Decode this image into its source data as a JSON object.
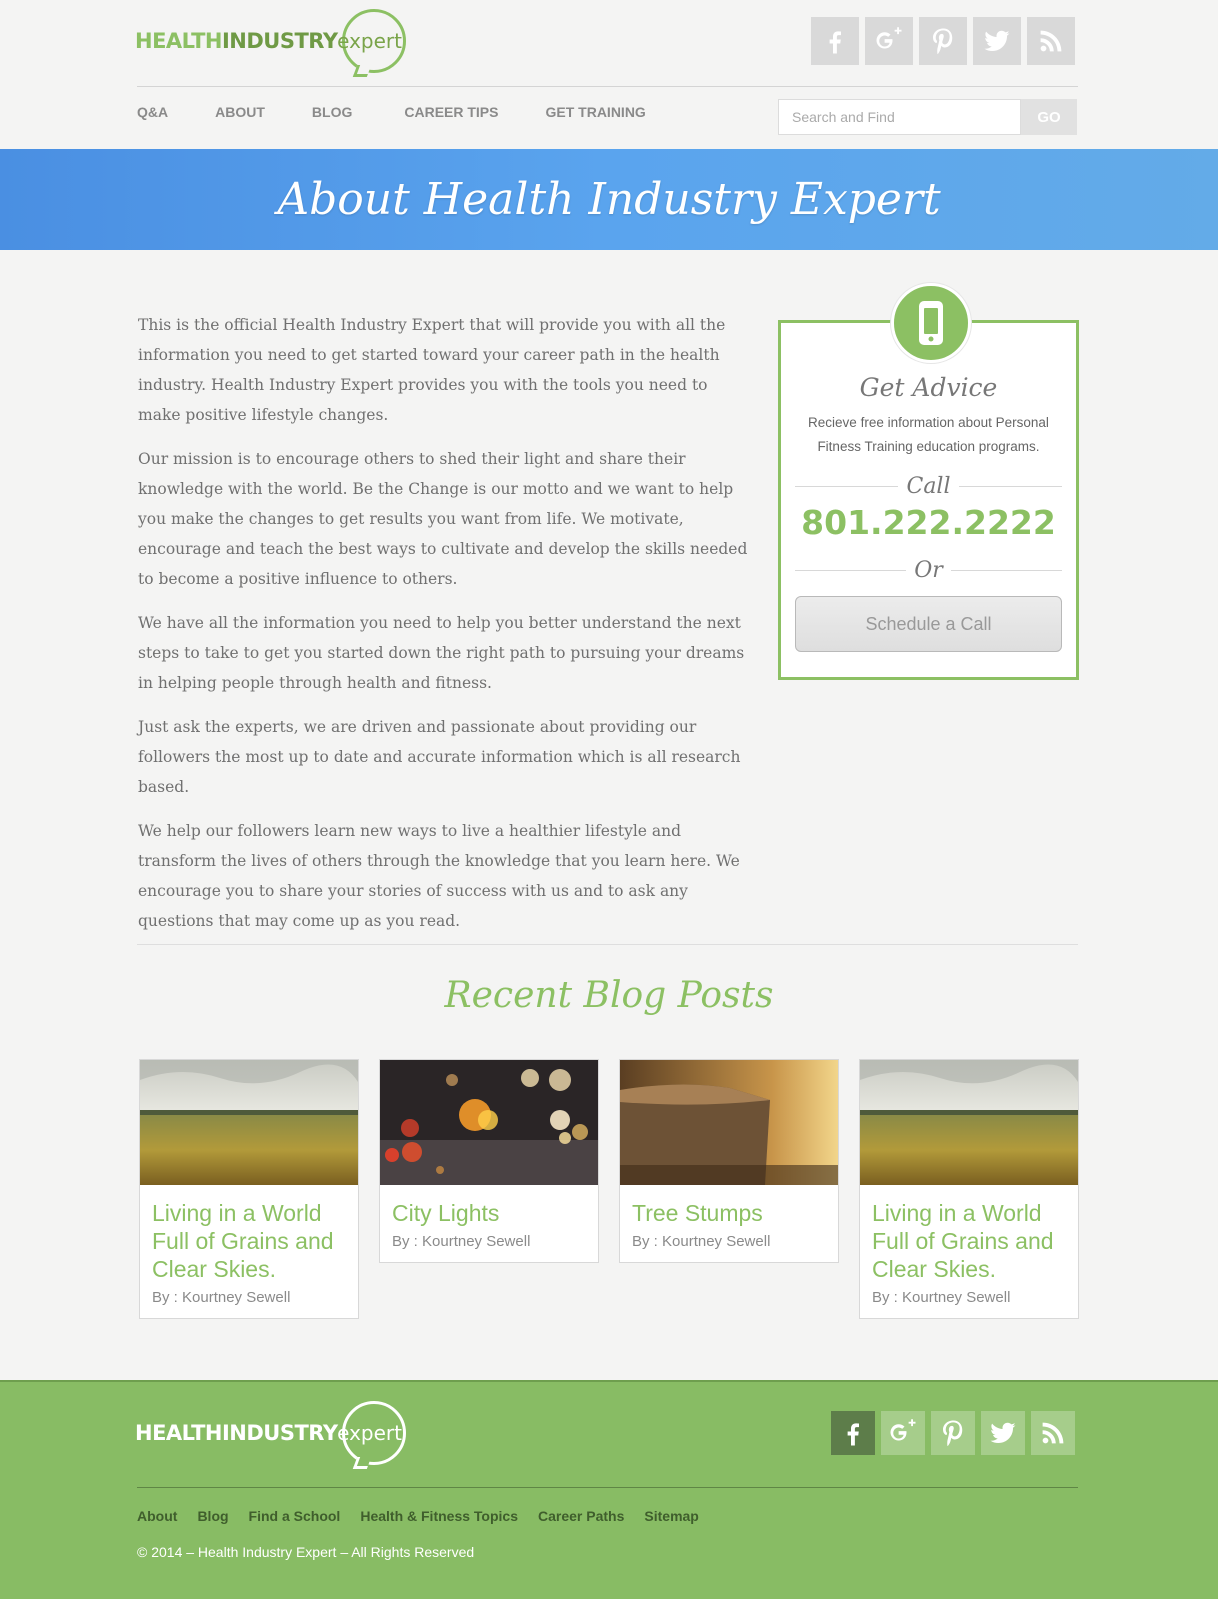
{
  "header": {
    "logo_health": "HEALTH",
    "logo_industry": "INDUSTRY",
    "logo_expert": "expert",
    "social": [
      "facebook-icon",
      "google-plus-icon",
      "pinterest-icon",
      "twitter-icon",
      "rss-icon"
    ]
  },
  "nav": {
    "items": [
      "Q&A",
      "ABOUT",
      "BLOG",
      "CAREER TIPS",
      "GET TRAINING"
    ]
  },
  "search": {
    "placeholder": "Search and Find",
    "button": "GO"
  },
  "banner": {
    "title": "About Health Industry Expert"
  },
  "content": {
    "paragraphs": [
      "This is the official Health Industry Expert that will provide you with all the information you need to get started toward your career path in the health industry. Health Industry Expert provides you with the tools you need to make positive lifestyle changes.",
      "Our mission is to encourage others to shed their light and share their knowledge with the world. Be the Change is our motto and we want to help you make the changes to get results you want from life. We motivate, encourage and teach the best ways to cultivate and develop the skills needed to become a positive influence to others.",
      "We have all the information you need to help you better understand the next steps to take to get you started down the right path to pursuing your dreams in helping people through health and fitness.",
      "Just ask the experts, we are driven and passionate about providing our followers the most up to date and accurate information which is all research based.",
      "We help our followers learn new ways to live a healthier lifestyle and transform the lives of others through the knowledge that you learn here. We encourage you to share your stories of success with us and to ask any questions that may come up as you read."
    ]
  },
  "advice": {
    "icon": "phone-icon",
    "title": "Get Advice",
    "description": "Recieve free information about Personal Fitness Training education programs.",
    "call_label": "Call",
    "phone": "801.222.2222",
    "or_label": "Or",
    "button": "Schedule a Call"
  },
  "recent": {
    "title": "Recent Blog Posts",
    "posts": [
      {
        "title": "Living in a World Full of Grains and Clear Skies.",
        "author": "By : Kourtney Sewell",
        "image": "wheat-field"
      },
      {
        "title": "City Lights",
        "author": "By : Kourtney Sewell",
        "image": "bokeh-lights"
      },
      {
        "title": "Tree Stumps",
        "author": "By : Kourtney Sewell",
        "image": "tree-stump"
      },
      {
        "title": "Living in a World Full of Grains and Clear Skies.",
        "author": "By : Kourtney Sewell",
        "image": "wheat-field"
      }
    ]
  },
  "footer": {
    "logo_health": "HEALTH",
    "logo_industry": "INDUSTRY",
    "logo_expert": "expert",
    "nav": [
      "About",
      "Blog",
      "Find a School",
      "Health & Fitness Topics",
      "Career Paths",
      "Sitemap"
    ],
    "copyright": "© 2014 – Health Industry Expert – All Rights Reserved"
  },
  "colors": {
    "accent_green": "#8cc063",
    "banner_blue": "#58a2ec",
    "footer_green": "#88bc64"
  }
}
